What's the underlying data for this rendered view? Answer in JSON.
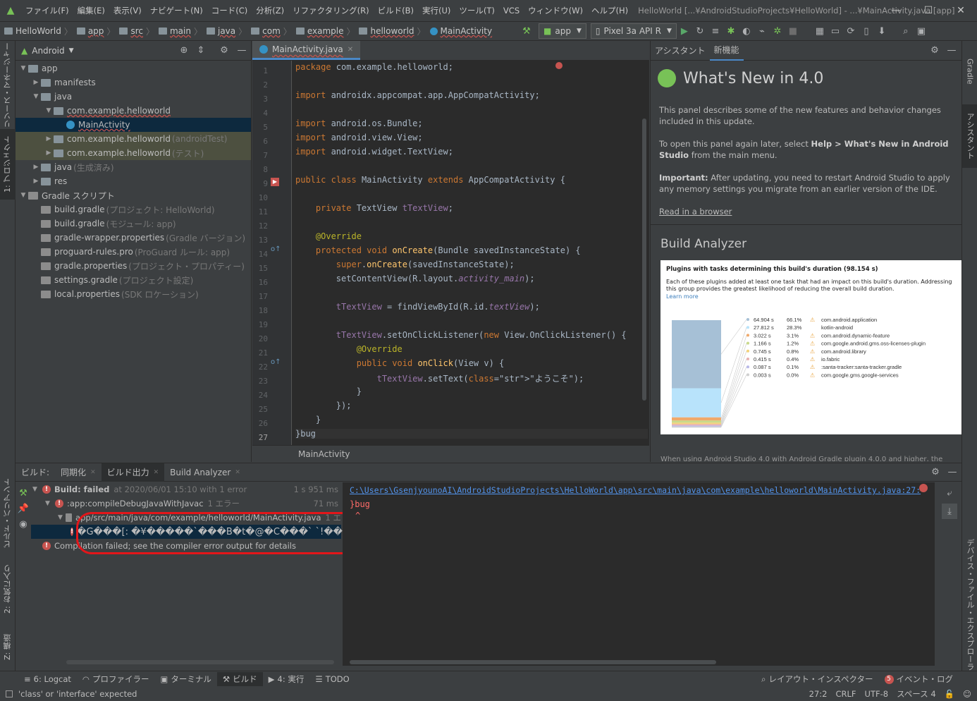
{
  "menubar": {
    "items": [
      "ファイル(F)",
      "編集(E)",
      "表示(V)",
      "ナビゲート(N)",
      "コード(C)",
      "分析(Z)",
      "リファクタリング(R)",
      "ビルド(B)",
      "実行(U)",
      "ツール(T)",
      "VCS",
      "ウィンドウ(W)",
      "ヘルプ(H)"
    ],
    "title": "HelloWorld [...¥AndroidStudioProjects¥HelloWorld] - ...¥MainActivity.java [app]"
  },
  "breadcrumb": [
    "HelloWorld",
    "app",
    "src",
    "main",
    "java",
    "com",
    "example",
    "helloworld",
    "MainActivity"
  ],
  "toolbar": {
    "run_config": "app",
    "device": "Pixel 3a API R"
  },
  "left_strip": {
    "resource_manager": "リソース・マネージャー",
    "project": "1: プロジェクト",
    "build_variants": "ビルド・バリアント",
    "favorites": "2: お気に入り",
    "structure": "Z: 構造"
  },
  "right_strip": {
    "gradle": "Gradle",
    "assistant": "アシスタント",
    "device_explorer": "デバイス・ファイル・エクスプローラー"
  },
  "project": {
    "view": "Android",
    "tree": [
      {
        "label": "app",
        "extra": "",
        "indent": 0,
        "arrow": "▼",
        "color": "#87939a"
      },
      {
        "label": "manifests",
        "extra": "",
        "indent": 1,
        "arrow": "▶",
        "color": "#87939a"
      },
      {
        "label": "java",
        "extra": "",
        "indent": 1,
        "arrow": "▼",
        "color": "#87939a"
      },
      {
        "label": "com.example.helloworld",
        "extra": "",
        "indent": 2,
        "arrow": "▼",
        "color": "#87939a"
      },
      {
        "label": "MainActivity",
        "extra": "",
        "indent": 3,
        "arrow": "",
        "color": "#3592c4"
      },
      {
        "label": "com.example.helloworld",
        "extra": "(androidTest)",
        "indent": 2,
        "arrow": "▶",
        "color": "#87939a"
      },
      {
        "label": "com.example.helloworld",
        "extra": "(テスト)",
        "indent": 2,
        "arrow": "▶",
        "color": "#87939a"
      },
      {
        "label": "java",
        "extra": "(生成済み)",
        "indent": 1,
        "arrow": "▶",
        "color": "#87939a"
      },
      {
        "label": "res",
        "extra": "",
        "indent": 1,
        "arrow": "▶",
        "color": "#87939a"
      },
      {
        "label": "Gradle スクリプト",
        "extra": "",
        "indent": 0,
        "arrow": "▼",
        "color": "#8c8c8c"
      },
      {
        "label": "build.gradle",
        "extra": "(プロジェクト: HelloWorld)",
        "indent": 1,
        "arrow": "",
        "color": "#8c8c8c"
      },
      {
        "label": "build.gradle",
        "extra": "(モジュール: app)",
        "indent": 1,
        "arrow": "",
        "color": "#8c8c8c"
      },
      {
        "label": "gradle-wrapper.properties",
        "extra": "(Gradle バージョン)",
        "indent": 1,
        "arrow": "",
        "color": "#8c8c8c"
      },
      {
        "label": "proguard-rules.pro",
        "extra": "(ProGuard ルール: app)",
        "indent": 1,
        "arrow": "",
        "color": "#8c8c8c"
      },
      {
        "label": "gradle.properties",
        "extra": "(プロジェクト・プロパティー)",
        "indent": 1,
        "arrow": "",
        "color": "#8c8c8c"
      },
      {
        "label": "settings.gradle",
        "extra": "(プロジェクト設定)",
        "indent": 1,
        "arrow": "",
        "color": "#8c8c8c"
      },
      {
        "label": "local.properties",
        "extra": "(SDK ロケーション)",
        "indent": 1,
        "arrow": "",
        "color": "#8c8c8c"
      }
    ]
  },
  "editor": {
    "tab": "MainActivity.java",
    "footer": "MainActivity",
    "line_numbers": [
      "1",
      "2",
      "3",
      "4",
      "5",
      "6",
      "7",
      "8",
      "9",
      "10",
      "11",
      "12",
      "13",
      "14",
      "15",
      "16",
      "17",
      "18",
      "19",
      "20",
      "21",
      "22",
      "23",
      "24",
      "25",
      "26",
      "27"
    ],
    "lines": [
      "package com.example.helloworld;",
      "",
      "import androidx.appcompat.app.AppCompatActivity;",
      "",
      "import android.os.Bundle;",
      "import android.view.View;",
      "import android.widget.TextView;",
      "",
      "public class MainActivity extends AppCompatActivity {",
      "",
      "    private TextView tTextView;",
      "",
      "    @Override",
      "    protected void onCreate(Bundle savedInstanceState) {",
      "        super.onCreate(savedInstanceState);",
      "        setContentView(R.layout.activity_main);",
      "",
      "        tTextView = findViewById(R.id.textView);",
      "",
      "        tTextView.setOnClickListener(new View.OnClickListener() {",
      "            @Override",
      "            public void onClick(View v) {",
      "                tTextView.setText(\"ようこそ\");",
      "            }",
      "        });",
      "    }",
      "}bug"
    ]
  },
  "assistant": {
    "tabs": [
      "アシスタント",
      "新機能"
    ],
    "heading": "What's New in 4.0",
    "p1": "This panel describes some of the new features and behavior changes included in this update.",
    "p2_a": "To open this panel again later, select ",
    "p2_b": "Help > What's New in Android Studio",
    "p2_c": " from the main menu.",
    "p3_a": "Important:",
    "p3_b": " After updating, you need to restart Android Studio to apply any memory settings you migrate from an earlier version of the IDE.",
    "link": "Read in a browser",
    "analyzer_heading": "Build Analyzer",
    "analyzer_title": "Plugins with tasks determining this build's duration (98.154 s)",
    "analyzer_desc": "Each of these plugins added at least one task that had an impact on this build's duration. Addressing this group provides the greatest likelihood of reducing the overall build duration.",
    "analyzer_learn": "Learn more",
    "cutoff": "When using Android Studio 4.0 with Android Gradle plugin 4.0.0 and higher, the"
  },
  "chart_data": {
    "type": "bar",
    "title": "Plugins with tasks determining this build's duration (98.154 s)",
    "categories": [
      "com.android.application",
      "kotlin-android",
      "com.android.dynamic-feature",
      "com.google.android.gms.oss-licenses-plugin",
      "com.android.library",
      "io.fabric",
      ":santa-tracker:santa-tracker.gradle",
      "com.google.gms.google-services"
    ],
    "durations": [
      "64.904 s",
      "27.812 s",
      "3.022 s",
      "1.166 s",
      "0.745 s",
      "0.415 s",
      "0.087 s",
      "0.003 s"
    ],
    "percents": [
      "66.1%",
      "28.3%",
      "3.1%",
      "1.2%",
      "0.8%",
      "0.4%",
      "0.1%",
      "0.0%"
    ],
    "values": [
      66.1,
      28.3,
      3.1,
      1.2,
      0.8,
      0.4,
      0.1,
      0.0
    ],
    "colors": [
      "#a6c0d6",
      "#b8e3fb",
      "#f0a96b",
      "#c9d98a",
      "#f3d27a",
      "#e8b0b0",
      "#b8b8e8",
      "#cfcfcf"
    ]
  },
  "build_panel": {
    "tabs": [
      "ビルド:",
      "同期化",
      "ビルド出力",
      "Build Analyzer"
    ],
    "tree": [
      {
        "label": "Build: failed",
        "extra": "at 2020/06/01 15:10 with 1 error",
        "time": "1 s 951 ms",
        "indent": 0,
        "arrow": "▼"
      },
      {
        "label": ":app:compileDebugJavaWithJavac",
        "extra": "1 エラー",
        "time": "71 ms",
        "indent": 1,
        "arrow": "▼"
      },
      {
        "label": "app/src/main/java/com/example/helloworld/MainActivity.java",
        "extra": "1 エ",
        "time": "",
        "indent": 2,
        "arrow": "▼"
      },
      {
        "label": "�G���[: �¥�����`���B�t�@�C���` `!���J�¿���",
        "extra": "",
        "time": "",
        "indent": 3,
        "arrow": ""
      },
      {
        "label": "Compilation failed; see the compiler error output for details",
        "extra": "",
        "time": "",
        "indent": 0,
        "arrow": ""
      }
    ],
    "console_path": "C:\\Users\\GsenjyounoAI\\AndroidStudioProjects\\HelloWorld\\app\\src\\main\\java\\com\\example\\helloworld\\MainActivity.java:27:",
    "console_line": "}bug",
    "console_caret": "^"
  },
  "bottom_tabs": [
    "6: Logcat",
    "プロファイラー",
    "ターミナル",
    "ビルド",
    "4: 実行",
    "TODO"
  ],
  "bottom_right": {
    "layout_inspector": "レイアウト・インスペクター",
    "event_log_count": "5",
    "event_log": "イベント・ログ"
  },
  "status": {
    "message": "'class' or 'interface' expected",
    "position": "27:2",
    "line_sep": "CRLF",
    "encoding": "UTF-8",
    "indent": "スペース 4"
  }
}
